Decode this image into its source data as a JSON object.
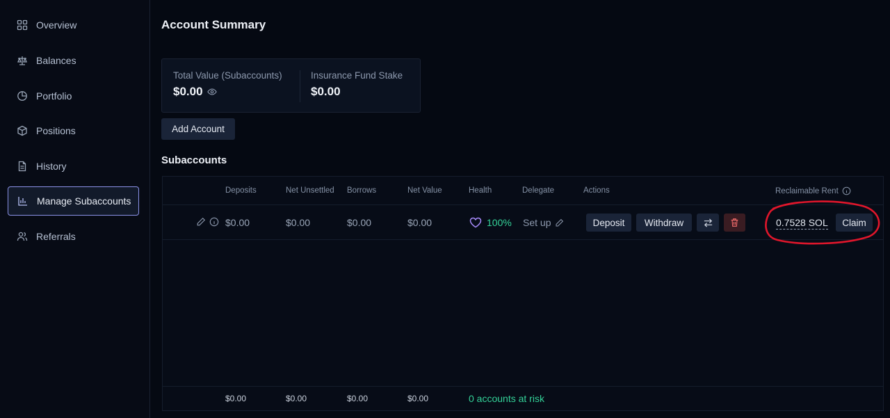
{
  "sidebar": {
    "items": [
      {
        "label": "Overview",
        "icon": "grid-icon"
      },
      {
        "label": "Balances",
        "icon": "scale-icon"
      },
      {
        "label": "Portfolio",
        "icon": "pie-chart-icon"
      },
      {
        "label": "Positions",
        "icon": "box-icon"
      },
      {
        "label": "History",
        "icon": "document-icon"
      },
      {
        "label": "Manage Subaccounts",
        "icon": "bar-chart-icon",
        "active": true
      },
      {
        "label": "Referrals",
        "icon": "users-icon"
      }
    ]
  },
  "summary": {
    "title": "Account Summary",
    "total_label": "Total Value (Subaccounts)",
    "total_value": "$0.00",
    "insurance_label": "Insurance Fund Stake",
    "insurance_value": "$0.00",
    "add_account_label": "Add Account"
  },
  "subaccounts": {
    "title": "Subaccounts",
    "columns": {
      "deposits": "Deposits",
      "net_unsettled": "Net Unsettled",
      "borrows": "Borrows",
      "net_value": "Net Value",
      "health": "Health",
      "delegate": "Delegate",
      "actions": "Actions",
      "reclaimable_rent": "Reclaimable Rent"
    },
    "row": {
      "deposits": "$0.00",
      "net_unsettled": "$0.00",
      "borrows": "$0.00",
      "net_value": "$0.00",
      "health": "100%",
      "delegate": "Set up",
      "deposit_button": "Deposit",
      "withdraw_button": "Withdraw",
      "rent_value": "0.7528 SOL",
      "claim_button": "Claim"
    },
    "footer": {
      "deposits": "$0.00",
      "net_unsettled": "$0.00",
      "borrows": "$0.00",
      "net_value": "$0.00",
      "at_risk": "0 accounts at risk"
    }
  },
  "colors": {
    "background": "#050912",
    "accent": "#8b92e8",
    "health_green": "#34d399",
    "annotation_red": "#e0162b",
    "delete_red": "#f06b6b"
  }
}
